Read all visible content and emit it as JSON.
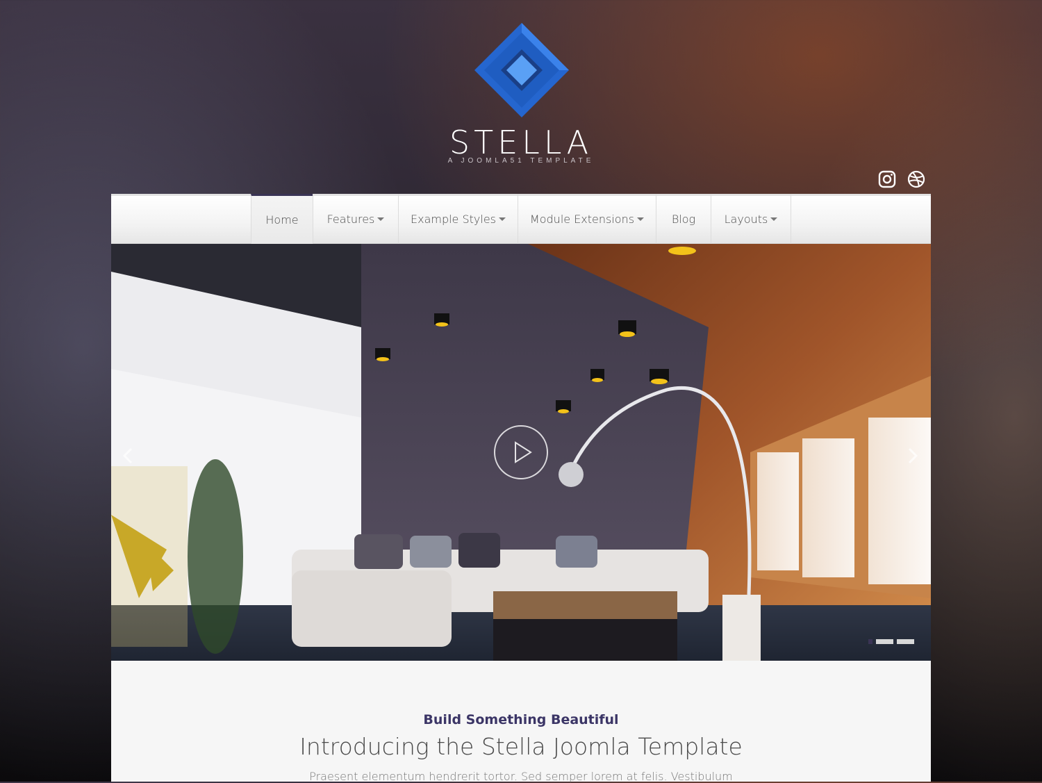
{
  "brand": {
    "title": "STELLA",
    "subtitle": "A JOOMLA51 TEMPLATE",
    "logo_icon": "diamond-logo-icon",
    "colors": {
      "logo_dark": "#1f5fc4",
      "logo_light": "#4a8ef0"
    }
  },
  "social": [
    {
      "icon": "instagram-icon"
    },
    {
      "icon": "dribbble-icon"
    }
  ],
  "nav": {
    "items": [
      {
        "label": "Home",
        "active": true,
        "dropdown": false
      },
      {
        "label": "Features",
        "dropdown": true
      },
      {
        "label": "Example Styles",
        "dropdown": true
      },
      {
        "label": "Module Extensions",
        "dropdown": true
      },
      {
        "label": "Blog",
        "dropdown": false
      },
      {
        "label": "Layouts",
        "dropdown": true
      }
    ],
    "active_color": "#3a3455"
  },
  "slider": {
    "prev_icon": "chevron-left-icon",
    "next_icon": "chevron-right-icon",
    "play_icon": "play-icon",
    "dot_count": 3,
    "active_dot": 0
  },
  "intro": {
    "kicker": "Build Something Beautiful",
    "title": "Introducing the Stella Joomla Template",
    "body": "Praesent elementum hendrerit tortor. Sed semper lorem at felis. Vestibulum"
  }
}
